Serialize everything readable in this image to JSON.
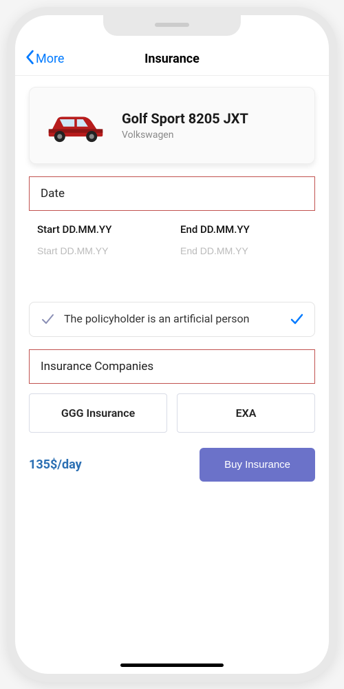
{
  "nav": {
    "back": "More",
    "title": "Insurance"
  },
  "car": {
    "name": "Golf Sport 8205 JXT",
    "make": "Volkswagen"
  },
  "date": {
    "header": "Date",
    "startLabel": "Start DD.MM.YY",
    "endLabel": "End DD.MM.YY",
    "startPlaceholder": "Start DD.MM.YY",
    "endPlaceholder": "End DD.MM.YY"
  },
  "policy": {
    "text": "The policyholder is an artificial person"
  },
  "companies": {
    "header": "Insurance Companies",
    "options": [
      "GGG Insurance",
      "EXA"
    ]
  },
  "footer": {
    "price": "135$/day",
    "buy": "Buy Insurance"
  }
}
